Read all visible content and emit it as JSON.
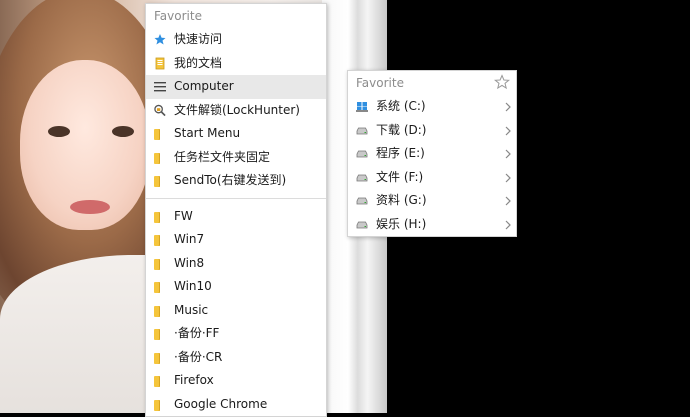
{
  "main_menu": {
    "header": "Favorite",
    "top_items": [
      {
        "label": "快速访问",
        "icon": "star-pin-icon"
      },
      {
        "label": "我的文档",
        "icon": "documents-icon"
      },
      {
        "label": "Computer",
        "icon": "hamburger-icon",
        "highlighted": true
      },
      {
        "label": "文件解锁(LockHunter)",
        "icon": "lockhunter-icon"
      },
      {
        "label": "Start Menu",
        "icon": "folder-icon"
      },
      {
        "label": "任务栏文件夹固定",
        "icon": "folder-icon"
      },
      {
        "label": "SendTo(右键发送到)",
        "icon": "folder-icon"
      }
    ],
    "bottom_items": [
      {
        "label": "FW",
        "icon": "folder-icon"
      },
      {
        "label": "Win7",
        "icon": "folder-icon"
      },
      {
        "label": "Win8",
        "icon": "folder-icon"
      },
      {
        "label": "Win10",
        "icon": "folder-icon"
      },
      {
        "label": "Music",
        "icon": "folder-icon"
      },
      {
        "label": "·备份·FF",
        "icon": "folder-icon"
      },
      {
        "label": "·备份·CR",
        "icon": "folder-icon"
      },
      {
        "label": "Firefox",
        "icon": "folder-icon"
      },
      {
        "label": "Google Chrome",
        "icon": "folder-icon"
      }
    ]
  },
  "sub_menu": {
    "header": "Favorite",
    "items": [
      {
        "label": "系统 (C:)",
        "icon": "system-drive-icon"
      },
      {
        "label": "下载 (D:)",
        "icon": "drive-icon"
      },
      {
        "label": "程序 (E:)",
        "icon": "drive-icon"
      },
      {
        "label": "文件 (F:)",
        "icon": "drive-icon"
      },
      {
        "label": "资料 (G:)",
        "icon": "drive-icon"
      },
      {
        "label": "娱乐 (H:)",
        "icon": "drive-icon"
      }
    ]
  },
  "colors": {
    "folder": "#f5c53b",
    "highlight": "#e8e8e8",
    "header_text": "#8c8c8c",
    "pin_blue": "#2f8fe0"
  }
}
